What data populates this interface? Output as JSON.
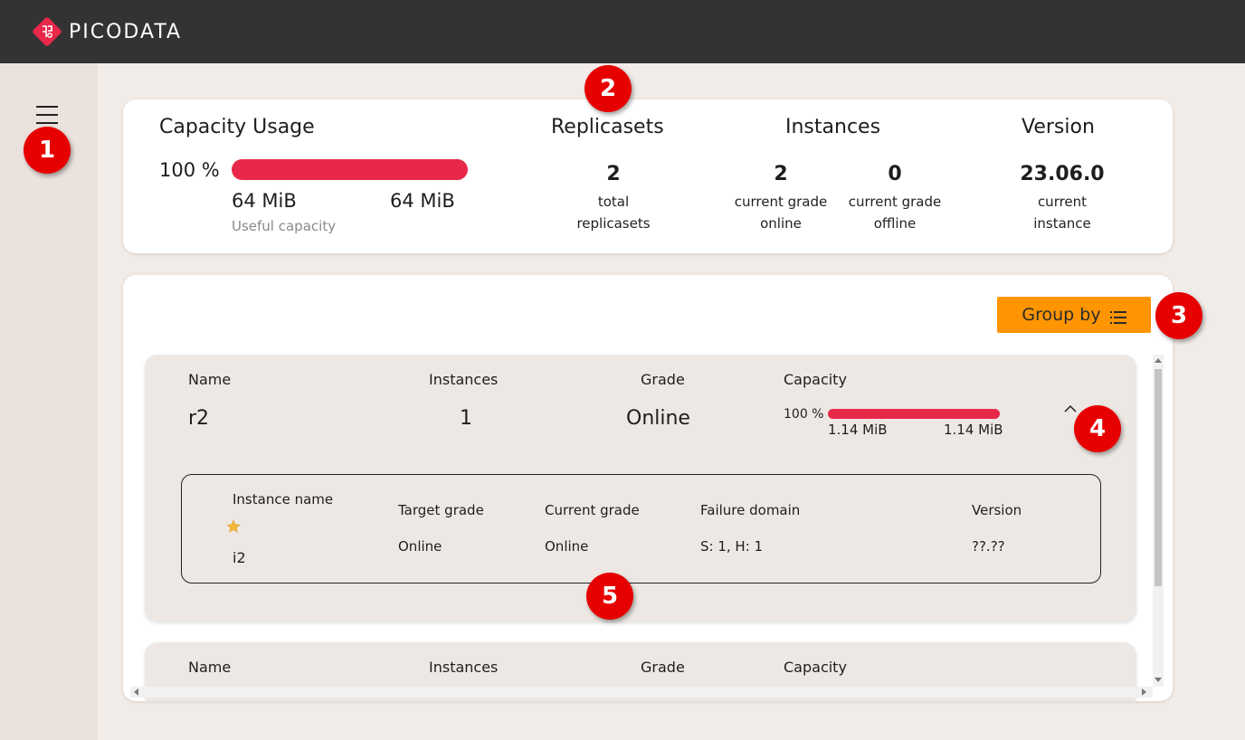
{
  "app": {
    "brand_name": "PICODATA",
    "colors": {
      "accent": "#ff9500",
      "bar": "#e8284a",
      "badge": "#e60000",
      "topbar": "#333333"
    }
  },
  "sidebar": {
    "menu_icon": "hamburger-menu-icon"
  },
  "summary": {
    "capacity": {
      "title": "Capacity Usage",
      "percent_label": "100 %",
      "percent_value": 100,
      "used": "64 MiB",
      "total": "64 MiB",
      "sub_label": "Useful capacity"
    },
    "replicasets": {
      "title": "Replicasets",
      "value": "2",
      "label_line1": "total",
      "label_line2": "replicasets"
    },
    "instances": {
      "title": "Instances",
      "online_value": "2",
      "online_line1": "current grade",
      "online_line2": "online",
      "offline_value": "0",
      "offline_line1": "current grade",
      "offline_line2": "offline"
    },
    "version": {
      "title": "Version",
      "value": "23.06.0",
      "label_line1": "current",
      "label_line2": "instance"
    }
  },
  "list": {
    "group_by_label": "Group by",
    "group_by_icon": "list-icon",
    "headers": {
      "name": "Name",
      "instances": "Instances",
      "grade": "Grade",
      "capacity": "Capacity"
    },
    "replicasets": [
      {
        "name": "r2",
        "instances": "1",
        "grade": "Online",
        "capacity_percent_label": "100 %",
        "capacity_percent_value": 100,
        "capacity_used": "1.14 MiB",
        "capacity_total": "1.14 MiB",
        "expanded": true,
        "instance_headers": {
          "name": "Instance name",
          "target_grade": "Target grade",
          "current_grade": "Current grade",
          "failure_domain": "Failure domain",
          "version": "Version"
        },
        "instances_list": [
          {
            "leader_icon": "star-icon",
            "name": "i2",
            "target_grade": "Online",
            "current_grade": "Online",
            "failure_domain": "S: 1, H: 1",
            "version": "??.??"
          }
        ]
      }
    ]
  },
  "annotations": [
    "1",
    "2",
    "3",
    "4",
    "5"
  ]
}
